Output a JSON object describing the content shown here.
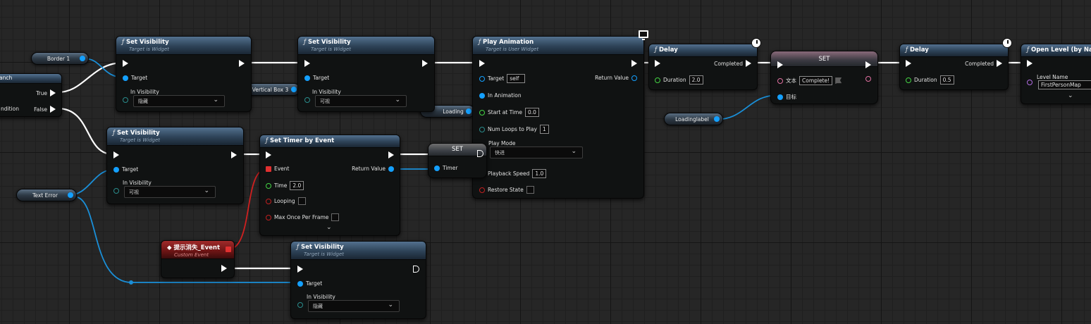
{
  "variables": {
    "border1": "Border 1",
    "vertical_box3": "Vertical Box 3",
    "loading": "Loading",
    "text_error": "Text Error",
    "loadinglabel": "Loadinglabel"
  },
  "branch": {
    "title": "anch",
    "true_label": "True",
    "false_label": "False",
    "condition_label": "ndition"
  },
  "set_vis_1": {
    "title": "Set Visibility",
    "subtitle": "Target is Widget",
    "target": "Target",
    "in_visibility": "In Visibility",
    "value": "隐藏"
  },
  "set_vis_2": {
    "title": "Set Visibility",
    "subtitle": "Target is Widget",
    "target": "Target",
    "in_visibility": "In Visibility",
    "value": "可视"
  },
  "set_vis_3": {
    "title": "Set Visibility",
    "subtitle": "Target is Widget",
    "target": "Target",
    "in_visibility": "In Visibility",
    "value": "可视"
  },
  "set_vis_4": {
    "title": "Set Visibility",
    "subtitle": "Target is Widget",
    "target": "Target",
    "in_visibility": "In Visibility",
    "value": "隐藏"
  },
  "play_anim": {
    "title": "Play Animation",
    "subtitle": "Target is User Widget",
    "target": "Target",
    "target_value": "self",
    "return_value": "Return Value",
    "in_animation": "In Animation",
    "start_at_time": "Start at Time",
    "start_at_time_value": "0.0",
    "num_loops": "Num Loops to Play",
    "num_loops_value": "1",
    "play_mode": "Play Mode",
    "play_mode_value": "快进",
    "playback_speed": "Playback Speed",
    "playback_speed_value": "1.0",
    "restore_state": "Restore State"
  },
  "set_timer": {
    "title": "Set Timer by Event",
    "event": "Event",
    "return_value": "Return Value",
    "time": "Time",
    "time_value": "2.0",
    "looping": "Looping",
    "max_once": "Max Once Per Frame"
  },
  "set_node_1": {
    "title": "SET",
    "timer": "Timer"
  },
  "custom_event": {
    "title": "提示消失_Event",
    "subtitle": "Custom Event"
  },
  "delay_1": {
    "title": "Delay",
    "completed": "Completed",
    "duration": "Duration",
    "duration_value": "2.0"
  },
  "set_node_2": {
    "title": "SET",
    "text_label": "文本",
    "text_value": "Complete!",
    "target_label": "目标"
  },
  "delay_2": {
    "title": "Delay",
    "completed": "Completed",
    "duration": "Duration",
    "duration_value": "0.5"
  },
  "open_level": {
    "title": "Open Level (by Nam",
    "level_name": "Level Name",
    "level_name_value": "FirstPersonMap"
  },
  "colors": {
    "exec_wire": "#ffffff",
    "object_wire": "#14a0ff",
    "header_blue": "#2d4257",
    "header_red": "#6a1414"
  }
}
